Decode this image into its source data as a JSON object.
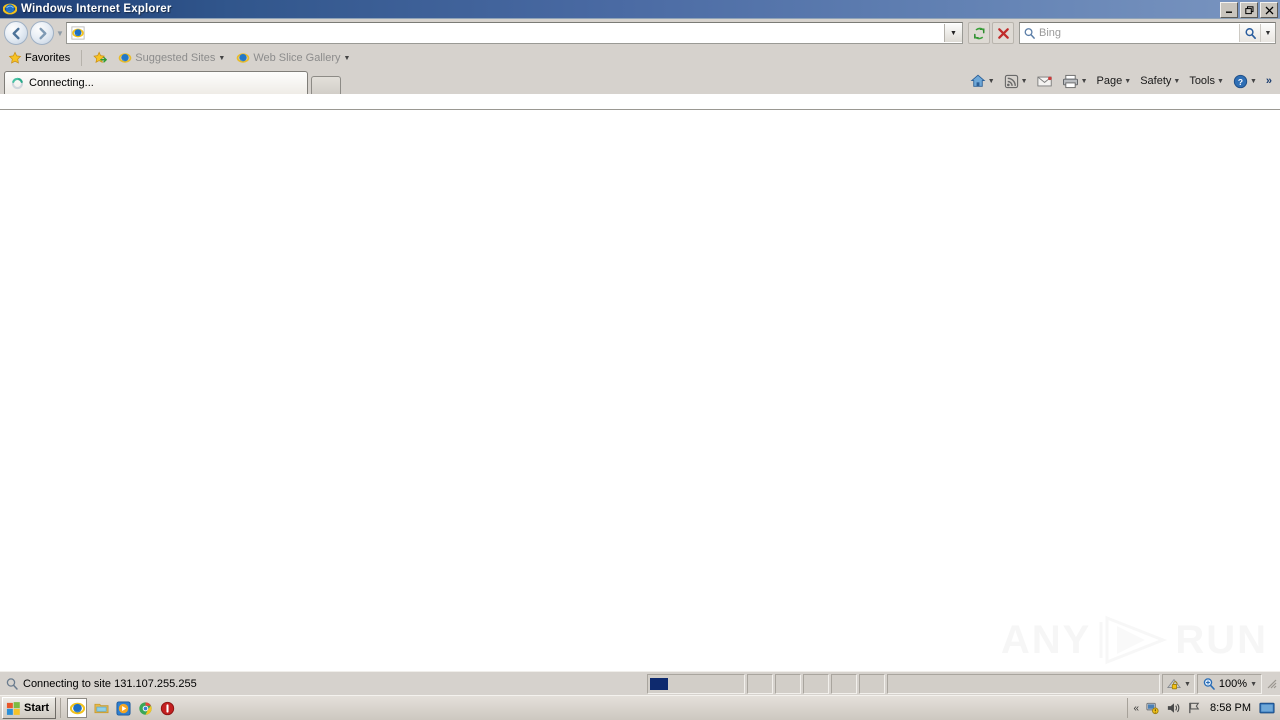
{
  "window": {
    "title": "Windows Internet Explorer",
    "icon": "internet-explorer-icon",
    "buttons": {
      "minimize": "_",
      "restore": "❐",
      "close": "✕"
    },
    "titlebar_gradient_from": "#1e3f76",
    "titlebar_gradient_to": "#7a95c0"
  },
  "navigation": {
    "back_label": "←",
    "forward_label": "→",
    "history_caret": "▼",
    "address": {
      "value": "",
      "placeholder": "",
      "icon": "internet-explorer-icon"
    },
    "address_dropdown": "▼",
    "refresh_label": "refresh-icon",
    "stop_label": "stop-icon"
  },
  "search": {
    "placeholder": "Bing",
    "value": "",
    "icon": "search-magnifier-icon",
    "go_icon": "search-go-icon",
    "dropdown": "▼"
  },
  "favorites_bar": {
    "favorites_label": "Favorites",
    "items": [
      {
        "label": "Suggested Sites",
        "icon": "internet-explorer-icon",
        "has_caret": true
      },
      {
        "label": "Web Slice Gallery",
        "icon": "internet-explorer-icon",
        "has_caret": true
      }
    ],
    "add_icon": "add-to-favorites-icon"
  },
  "tabs": {
    "active": {
      "label": "Connecting...",
      "icon": "loading-spinner-icon"
    },
    "new_tab_label": ""
  },
  "command_bar": {
    "home": {
      "icon": "home-icon",
      "caret": "▼"
    },
    "feeds": {
      "icon": "rss-feed-icon",
      "caret": "▼"
    },
    "mail": {
      "icon": "mail-icon"
    },
    "print": {
      "icon": "printer-icon",
      "caret": "▼"
    },
    "menus": [
      {
        "label": "Page",
        "caret": "▼"
      },
      {
        "label": "Safety",
        "caret": "▼"
      },
      {
        "label": "Tools",
        "caret": "▼"
      }
    ],
    "help": {
      "icon": "help-icon",
      "caret": "▼"
    },
    "overflow": "»"
  },
  "content": {
    "page_text": "",
    "watermark": {
      "left_text": "ANY",
      "right_text": "RUN",
      "icon": "play-triangle-icon"
    }
  },
  "status_bar": {
    "message": "Connecting to site 131.107.255.255",
    "message_icon": "search-magnifier-icon",
    "progress_percent": 12,
    "zone": {
      "icon": "security-zone-lock-icon",
      "caret": "▼"
    },
    "zoom": {
      "level": "100%",
      "icon": "zoom-icon",
      "caret": "▼"
    }
  },
  "taskbar": {
    "start_label": "Start",
    "start_icon": "windows-flag-icon",
    "quick_launch": [
      {
        "name": "internet-explorer-icon",
        "active": true
      },
      {
        "name": "file-explorer-icon",
        "active": false
      },
      {
        "name": "media-player-icon",
        "active": false
      },
      {
        "name": "chrome-icon",
        "active": false
      },
      {
        "name": "red-shield-icon",
        "active": false
      }
    ],
    "tray": {
      "expand": "«",
      "icons": [
        "network-icon",
        "volume-icon",
        "flag-icon"
      ],
      "time": "8:58 PM",
      "show_desktop": "show-desktop-icon"
    }
  }
}
